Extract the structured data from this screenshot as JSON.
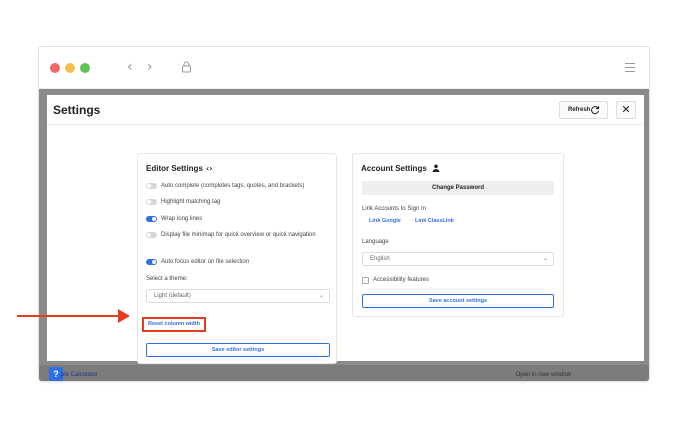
{
  "modal": {
    "title": "Settings",
    "refresh_label": "Refresh",
    "close_label": "✕"
  },
  "editor": {
    "title": "Editor Settings",
    "title_icon": "‹›",
    "options": [
      {
        "label": "Auto complete (completes tags, quotes, and brackets)",
        "on": false
      },
      {
        "label": "Highlight matching tag",
        "on": false
      },
      {
        "label": "Wrap long lines",
        "on": true
      },
      {
        "label": "Display file minimap for quick overview or quick navigation",
        "on": false
      },
      {
        "label": "Auto focus editor on file selection",
        "on": true
      }
    ],
    "theme_label": "Select a theme:",
    "theme_value": "Light (default)",
    "reset_label": "Reset column width",
    "save_label": "Save editor settings"
  },
  "account": {
    "title": "Account Settings",
    "change_password_label": "Change Password",
    "link_accounts_label": "Link Accounts to Sign In",
    "link_google": "Link Google",
    "link_classlink": "Link ClassLink",
    "language_label": "Language",
    "language_value": "English",
    "accessibility_label": "Accessibility features",
    "save_label": "Save account settings"
  },
  "background": {
    "help_label": "?",
    "link_text": "ple Calculator",
    "open_window_text": "Open in new window"
  },
  "colors": {
    "accent": "#2f6fe3",
    "annotation": "#e53b1f"
  }
}
